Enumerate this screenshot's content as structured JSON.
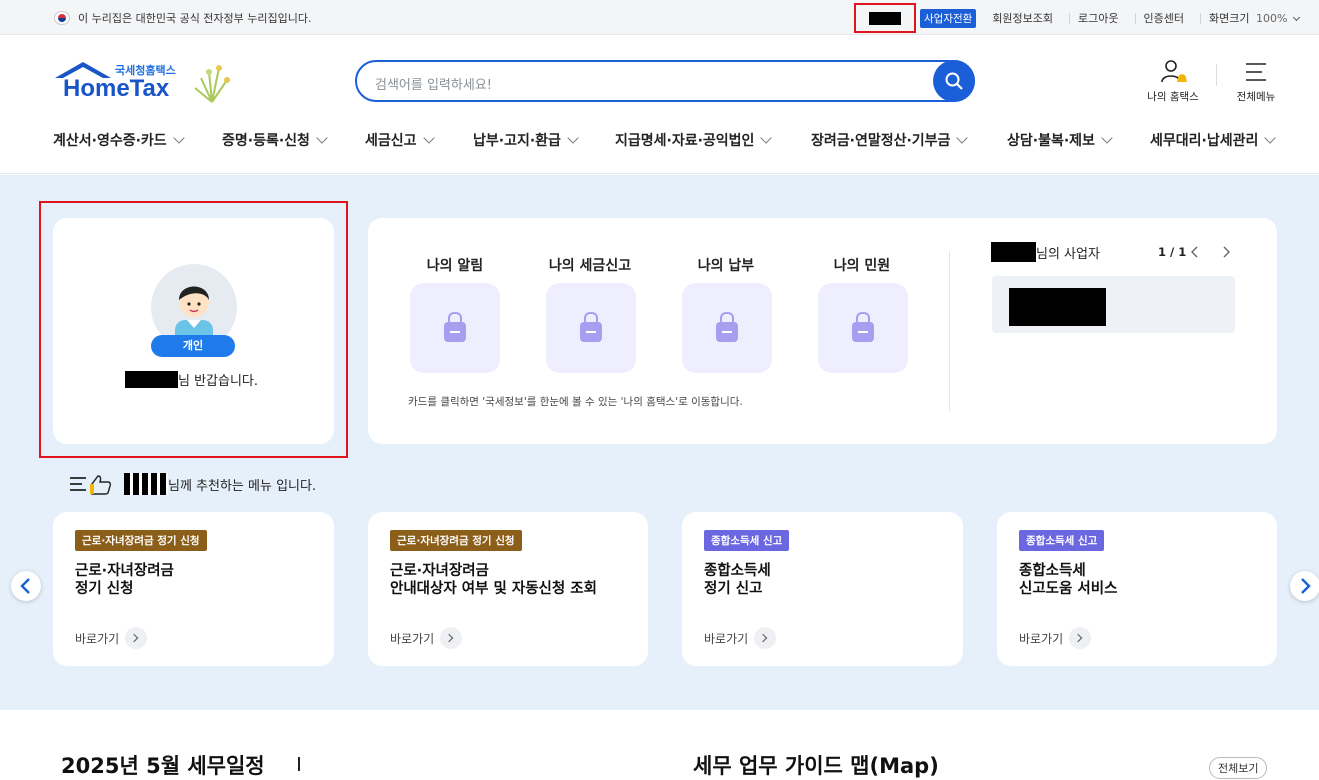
{
  "topbar": {
    "gov_notice": "이 누리집은 대한민국 공식 전자정부 누리집입니다.",
    "biz_switch": "사업자전환",
    "links": [
      "회원정보조회",
      "로그아웃",
      "인증센터",
      "화면크기"
    ],
    "zoom": "100%"
  },
  "logo": {
    "sub": "국세청홈택스",
    "main": "HomeTax"
  },
  "search": {
    "placeholder": "검색어를 입력하세요!"
  },
  "header_right": {
    "my_hometax": "나의 홈택스",
    "all_menu": "전체메뉴"
  },
  "nav": [
    "계산서·영수증·카드",
    "증명·등록·신청",
    "세금신고",
    "납부·고지·환급",
    "지급명세·자료·공익법인",
    "장려금·연말정산·기부금",
    "상담·불복·제보",
    "세무대리·납세관리"
  ],
  "profile": {
    "badge": "개인",
    "greeting_suffix": "님 반갑습니다."
  },
  "my_tiles": [
    "나의 알림",
    "나의 세금신고",
    "나의 납부",
    "나의 민원"
  ],
  "my_tiles_note": "카드를 클릭하면 '국세정보'를 한눈에 볼 수 있는 '나의 홈택스'로 이동합니다.",
  "business": {
    "suffix": "님의 사업자",
    "pager": "1 / 1"
  },
  "recommend": {
    "suffix": "님께 추천하는 메뉴 입니다."
  },
  "rec_cards": [
    {
      "tag": "근로·자녀장려금 정기 신청",
      "line1": "근로·자녀장려금",
      "line2": "정기 신청",
      "go": "바로가기"
    },
    {
      "tag": "근로·자녀장려금 정기 신청",
      "line1": "근로·자녀장려금",
      "line2": "안내대상자 여부 및 자동신청 조회",
      "go": "바로가기"
    },
    {
      "tag": "종합소득세 신고",
      "line1": "종합소득세",
      "line2": "정기 신고",
      "go": "바로가기"
    },
    {
      "tag": "종합소득세 신고",
      "line1": "종합소득세",
      "line2": "신고도움 서비스",
      "go": "바로가기"
    }
  ],
  "colors": {
    "brand_blue": "#1a5fd8",
    "tag_brown": "#8b5e1a",
    "tag_purple": "#6b67e0",
    "hero_bg": "#e5f0fa",
    "highlight_red": "#e0141e"
  },
  "bottom": {
    "left_title": "2025년 5월 세무일정",
    "right_title": "세무 업무 가이드 맵(Map)",
    "view_all": "전체보기"
  }
}
